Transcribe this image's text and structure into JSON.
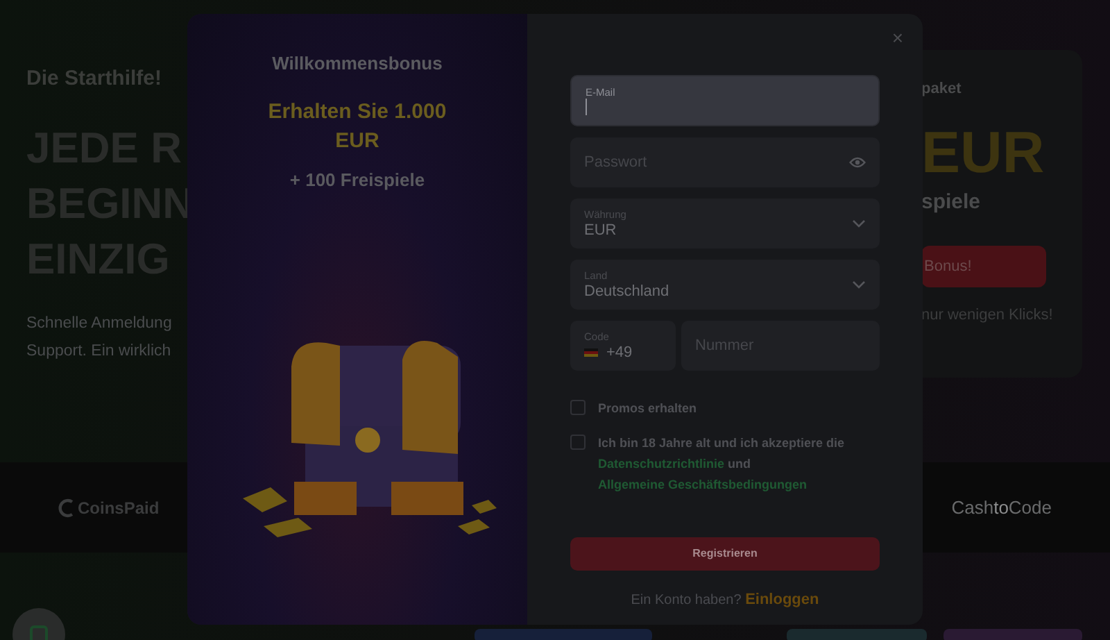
{
  "hero": {
    "eyebrow": "Die Starthilfe!",
    "heading_lines": [
      "JEDE R",
      "BEGINN",
      "EINZIG"
    ],
    "description_lines": [
      "Schnelle Anmeldung",
      "Support. Ein wirklich"
    ]
  },
  "promo_card": {
    "label": "paket",
    "amount": "EUR",
    "subtitle": "spiele",
    "button": "Bonus!",
    "note": "nur wenigen Klicks!"
  },
  "payment_logos": [
    {
      "kind": "coinspaid",
      "text": "CoinsPaid"
    },
    {
      "kind": "cashtocode",
      "parts": [
        "Cash",
        "to",
        "Code"
      ]
    }
  ],
  "modal": {
    "close": "×",
    "bonus": {
      "title": "Willkommensbonus",
      "offer": "Erhalten Sie 1.000 EUR",
      "extra": "+ 100 Freispiele"
    },
    "fields": [
      {
        "kind": "text",
        "label": "E-Mail",
        "focused": true
      },
      {
        "kind": "password",
        "placeholder": "Passwort"
      },
      {
        "kind": "select",
        "label": "Währung",
        "value": "EUR"
      },
      {
        "kind": "select",
        "label": "Land",
        "value": "Deutschland"
      },
      {
        "kind": "phone",
        "label": "Code",
        "value": "+49",
        "number_placeholder": "Nummer"
      }
    ],
    "checkboxes": [
      {
        "kind": "plain",
        "label": "Promos erhalten",
        "checked": false
      },
      {
        "kind": "terms",
        "text": "Ich bin 18 Jahre alt und ich akzeptiere die",
        "link_1": "Datenschutzrichtlinie",
        "joiner": "und",
        "link_2": "Allgemeine Geschäftsbedingungen",
        "checked": false
      }
    ],
    "submit": "Registrieren",
    "footer": {
      "question": "Ein Konto haben?",
      "link": "Einloggen"
    }
  }
}
